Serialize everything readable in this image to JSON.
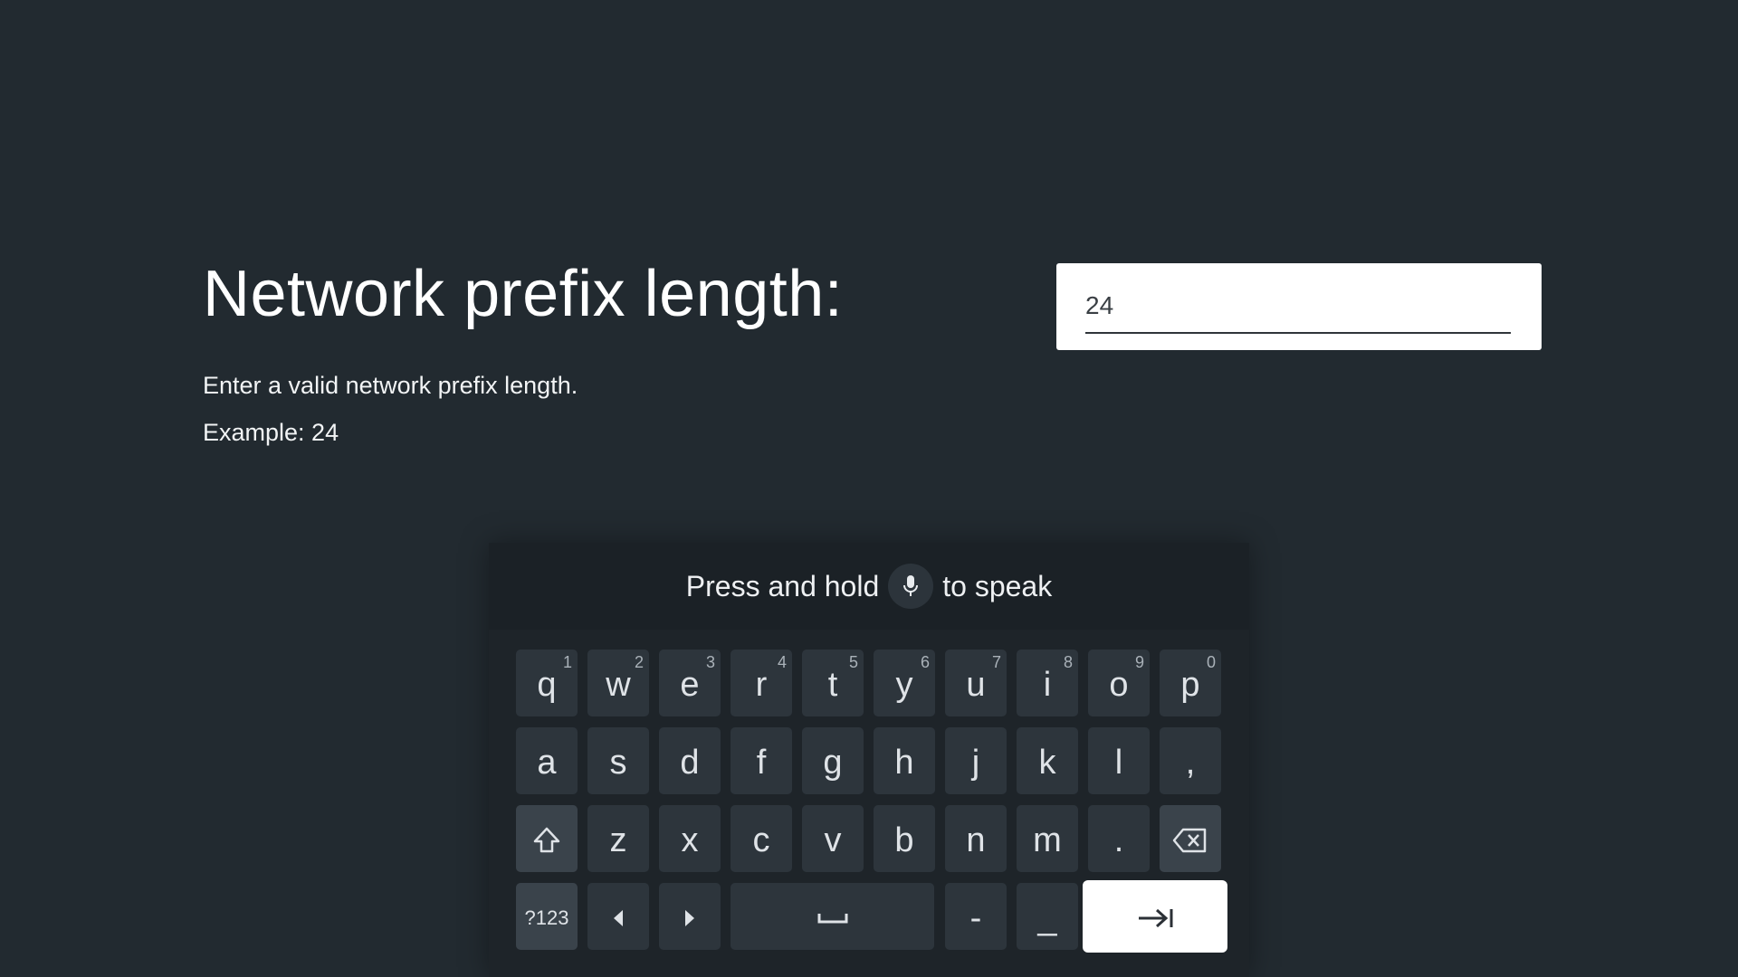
{
  "page": {
    "title": "Network prefix length:",
    "description": "Enter a valid network prefix length.",
    "example": "Example: 24"
  },
  "input": {
    "value": "24"
  },
  "keyboard": {
    "voice_hint_before": "Press and hold",
    "voice_hint_after": "to speak",
    "row1": [
      {
        "key": "q",
        "num": "1"
      },
      {
        "key": "w",
        "num": "2"
      },
      {
        "key": "e",
        "num": "3"
      },
      {
        "key": "r",
        "num": "4"
      },
      {
        "key": "t",
        "num": "5"
      },
      {
        "key": "y",
        "num": "6"
      },
      {
        "key": "u",
        "num": "7"
      },
      {
        "key": "i",
        "num": "8"
      },
      {
        "key": "o",
        "num": "9"
      },
      {
        "key": "p",
        "num": "0"
      }
    ],
    "row2": [
      "a",
      "s",
      "d",
      "f",
      "g",
      "h",
      "j",
      "k",
      "l",
      ","
    ],
    "row3": [
      "z",
      "x",
      "c",
      "v",
      "b",
      "n",
      "m",
      "."
    ],
    "row4": {
      "symbols": "?123",
      "dash": "-",
      "underscore": "_"
    },
    "icons": {
      "mic": "microphone-icon",
      "shift": "shift-icon",
      "backspace": "backspace-icon",
      "left": "arrow-left-icon",
      "right": "arrow-right-icon",
      "space": "space-icon",
      "next": "tab-next-icon"
    }
  }
}
